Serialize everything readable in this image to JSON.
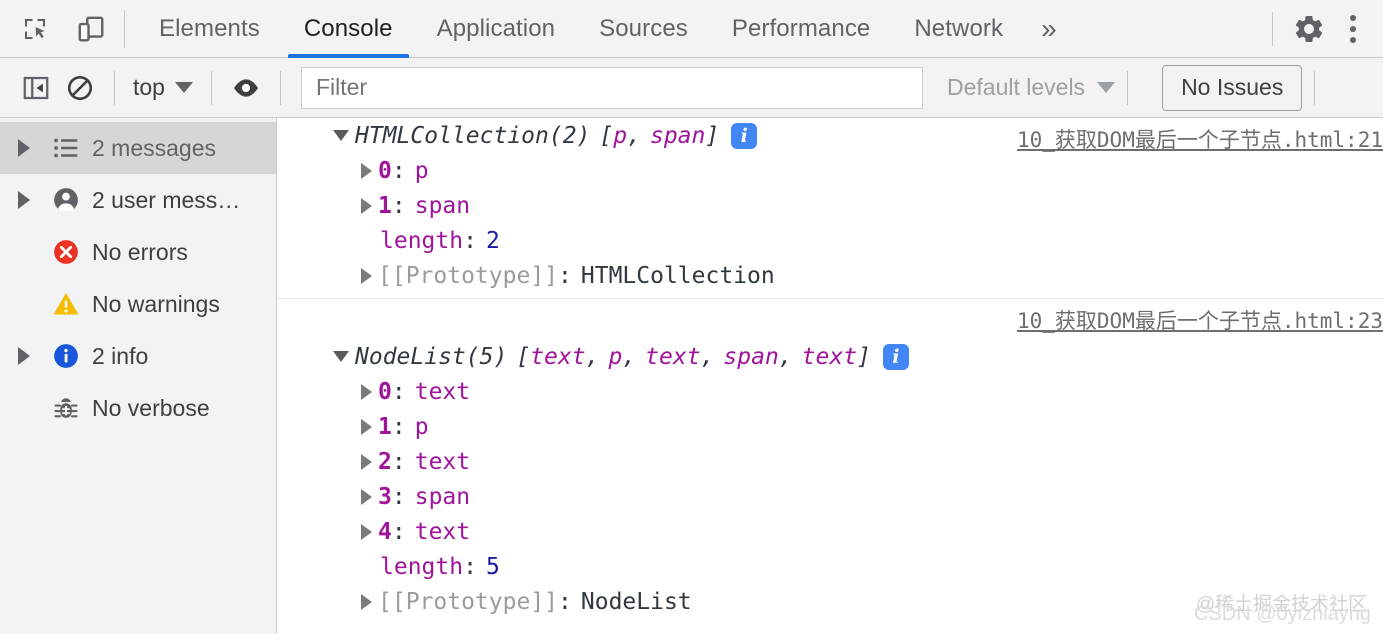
{
  "devtools": {
    "toolbar": {
      "inspect_icon": "inspect-element-icon",
      "device_icon": "device-toolbar-icon",
      "settings_icon": "gear-icon",
      "more_icon": "kebab-menu-icon",
      "overflow_label": "»",
      "tabs": [
        {
          "label": "Elements",
          "active": false
        },
        {
          "label": "Console",
          "active": true
        },
        {
          "label": "Application",
          "active": false
        },
        {
          "label": "Sources",
          "active": false
        },
        {
          "label": "Performance",
          "active": false
        },
        {
          "label": "Network",
          "active": false
        }
      ]
    },
    "filterbar": {
      "sidebar_toggle_icon": "sidebar-toggle-icon",
      "clear_icon": "clear-console-icon",
      "context_label": "top",
      "eye_icon": "live-expression-eye-icon",
      "filter_placeholder": "Filter",
      "filter_value": "",
      "levels_label": "Default levels",
      "issues_label": "No Issues"
    },
    "sidebar": {
      "items": [
        {
          "label": "2 messages",
          "icon": "list-icon",
          "expandable": true,
          "selected": true
        },
        {
          "label": "2 user mess…",
          "icon": "user-icon",
          "expandable": true,
          "selected": false
        },
        {
          "label": "No errors",
          "icon": "error-icon",
          "expandable": false,
          "selected": false
        },
        {
          "label": "No warnings",
          "icon": "warning-icon",
          "expandable": false,
          "selected": false
        },
        {
          "label": "2 info",
          "icon": "info-icon",
          "expandable": true,
          "selected": false
        },
        {
          "label": "No verbose",
          "icon": "bug-icon",
          "expandable": false,
          "selected": false
        }
      ]
    },
    "console": {
      "messages": [
        {
          "source_link": "10_获取DOM最后一个子节点.html:21",
          "type_name": "HTMLCollection(2)",
          "preview_open": "[",
          "preview_items": [
            "p",
            "span"
          ],
          "preview_close": "]",
          "badge": "i",
          "rows": [
            {
              "expandable": true,
              "key": "0",
              "value": "p",
              "value_kind": "elem"
            },
            {
              "expandable": true,
              "key": "1",
              "value": "span",
              "value_kind": "elem"
            },
            {
              "expandable": false,
              "key": "length",
              "value": "2",
              "value_kind": "number"
            },
            {
              "expandable": true,
              "key": "[[Prototype]]",
              "value": "HTMLCollection",
              "value_kind": "proto"
            }
          ]
        },
        {
          "source_link": "10_获取DOM最后一个子节点.html:23",
          "type_name": "NodeList(5)",
          "preview_open": "[",
          "preview_items": [
            "text",
            "p",
            "text",
            "span",
            "text"
          ],
          "preview_close": "]",
          "badge": "i",
          "rows": [
            {
              "expandable": true,
              "key": "0",
              "value": "text",
              "value_kind": "elem"
            },
            {
              "expandable": true,
              "key": "1",
              "value": "p",
              "value_kind": "elem"
            },
            {
              "expandable": true,
              "key": "2",
              "value": "text",
              "value_kind": "elem"
            },
            {
              "expandable": true,
              "key": "3",
              "value": "span",
              "value_kind": "elem"
            },
            {
              "expandable": true,
              "key": "4",
              "value": "text",
              "value_kind": "elem"
            },
            {
              "expandable": false,
              "key": "length",
              "value": "5",
              "value_kind": "number"
            },
            {
              "expandable": true,
              "key": "[[Prototype]]",
              "value": "NodeList",
              "value_kind": "proto"
            }
          ]
        }
      ]
    },
    "watermarks": {
      "primary": "@稀土掘金技术社区",
      "secondary": "CSDN @0yizhiayng"
    },
    "colors": {
      "accent": "#1a73e8",
      "chrome_bg": "#f3f3f3",
      "sidebar_bg": "#f1f3f4",
      "selected_row": "#d6d6d6",
      "property_magenta": "#a0149c",
      "number_blue": "#1a1aa6",
      "error_red": "#ea4335",
      "warning_yellow": "#f5bb00",
      "info_blue": "#1a73e8",
      "badge_blue": "#4285f4"
    }
  }
}
